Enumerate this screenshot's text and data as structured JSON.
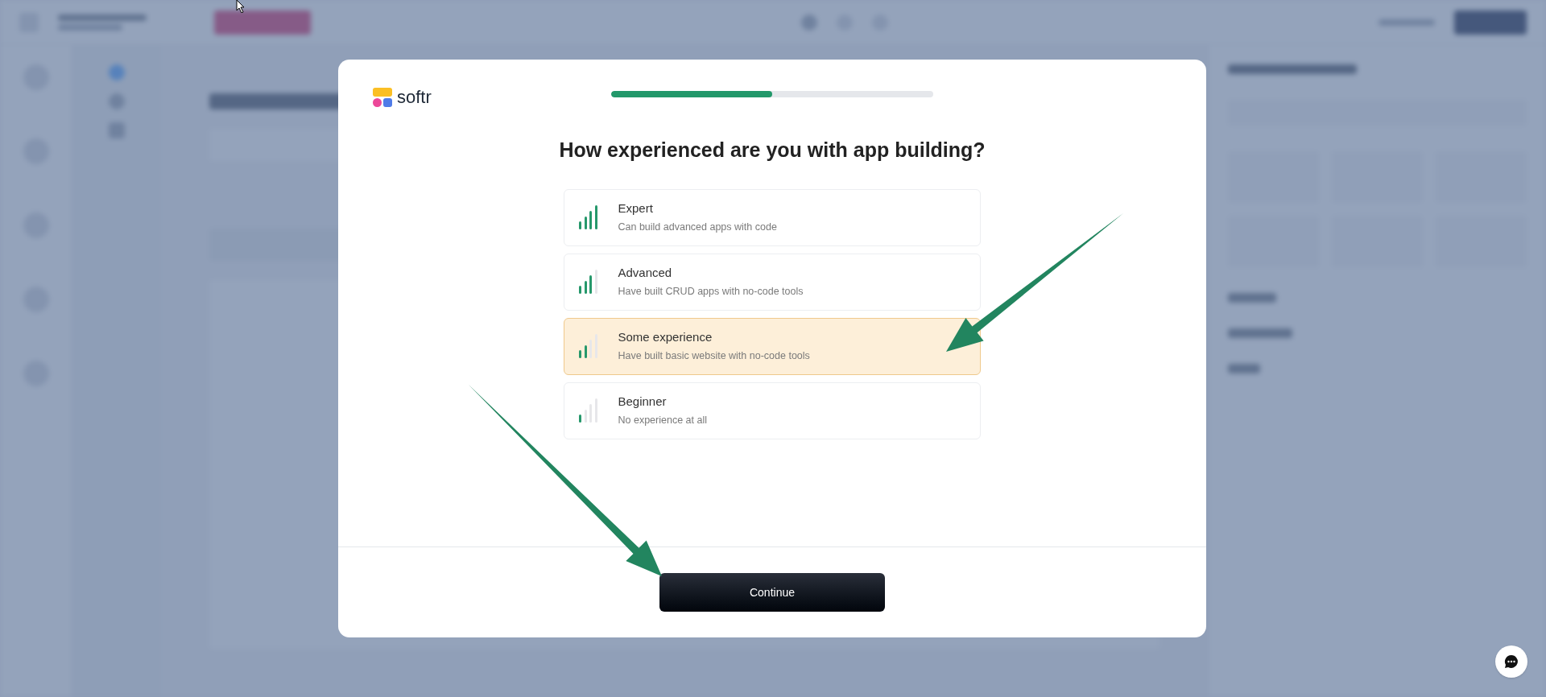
{
  "modal": {
    "logo": {
      "text": "softr"
    },
    "progress": {
      "level": 0.5
    },
    "question": "How experienced are you with app building?",
    "options": [
      {
        "title": "Expert",
        "description": "Can build advanced apps with code",
        "kind": "expert",
        "selected": false
      },
      {
        "title": "Advanced",
        "description": "Have built CRUD apps with no-code tools",
        "kind": "advanced",
        "selected": false
      },
      {
        "title": "Some experience",
        "description": "Have built basic website with no-code tools",
        "kind": "intermediate",
        "selected": true
      },
      {
        "title": "Beginner",
        "description": "No experience at all",
        "kind": "beginner",
        "selected": false
      }
    ],
    "continue_button": "Continue"
  }
}
